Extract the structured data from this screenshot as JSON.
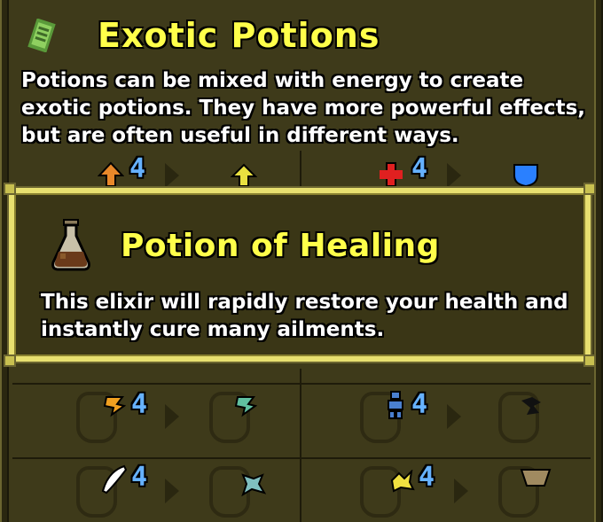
{
  "header": {
    "title": "Exotic Potions",
    "icon": "scroll-icon",
    "description": "Potions can be mixed with energy to create exotic potions. They have more powerful effects, but are often useful in different ways."
  },
  "top_row": [
    {
      "input_icon": "orange-arrow-icon",
      "count": "4",
      "output_icon": "yellow-arrow-icon"
    },
    {
      "input_icon": "red-cross-icon",
      "count": "4",
      "output_icon": "blue-shield-icon"
    }
  ],
  "popup": {
    "title": "Potion of Healing",
    "icon": "healing-potion-flask-icon",
    "description": "This elixir will rapidly restore your health and instantly cure many ailments."
  },
  "recipe_rows": [
    [
      {
        "input_icon": "orange-rune-icon",
        "count": "4",
        "output_icon": "teal-rune-icon"
      },
      {
        "input_icon": "blue-figure-icon",
        "count": "4",
        "output_icon": "black-swirl-icon"
      }
    ],
    [
      {
        "input_icon": "white-feather-icon",
        "count": "4",
        "output_icon": "cyan-swirl-icon"
      },
      {
        "input_icon": "yellow-sparkle-icon",
        "count": "4",
        "output_icon": "tan-bowl-icon"
      }
    ]
  ],
  "colors": {
    "title": "#ffff4a",
    "count": "#66b2ff",
    "border": "#e8e070",
    "background": "#3e3a1a"
  }
}
